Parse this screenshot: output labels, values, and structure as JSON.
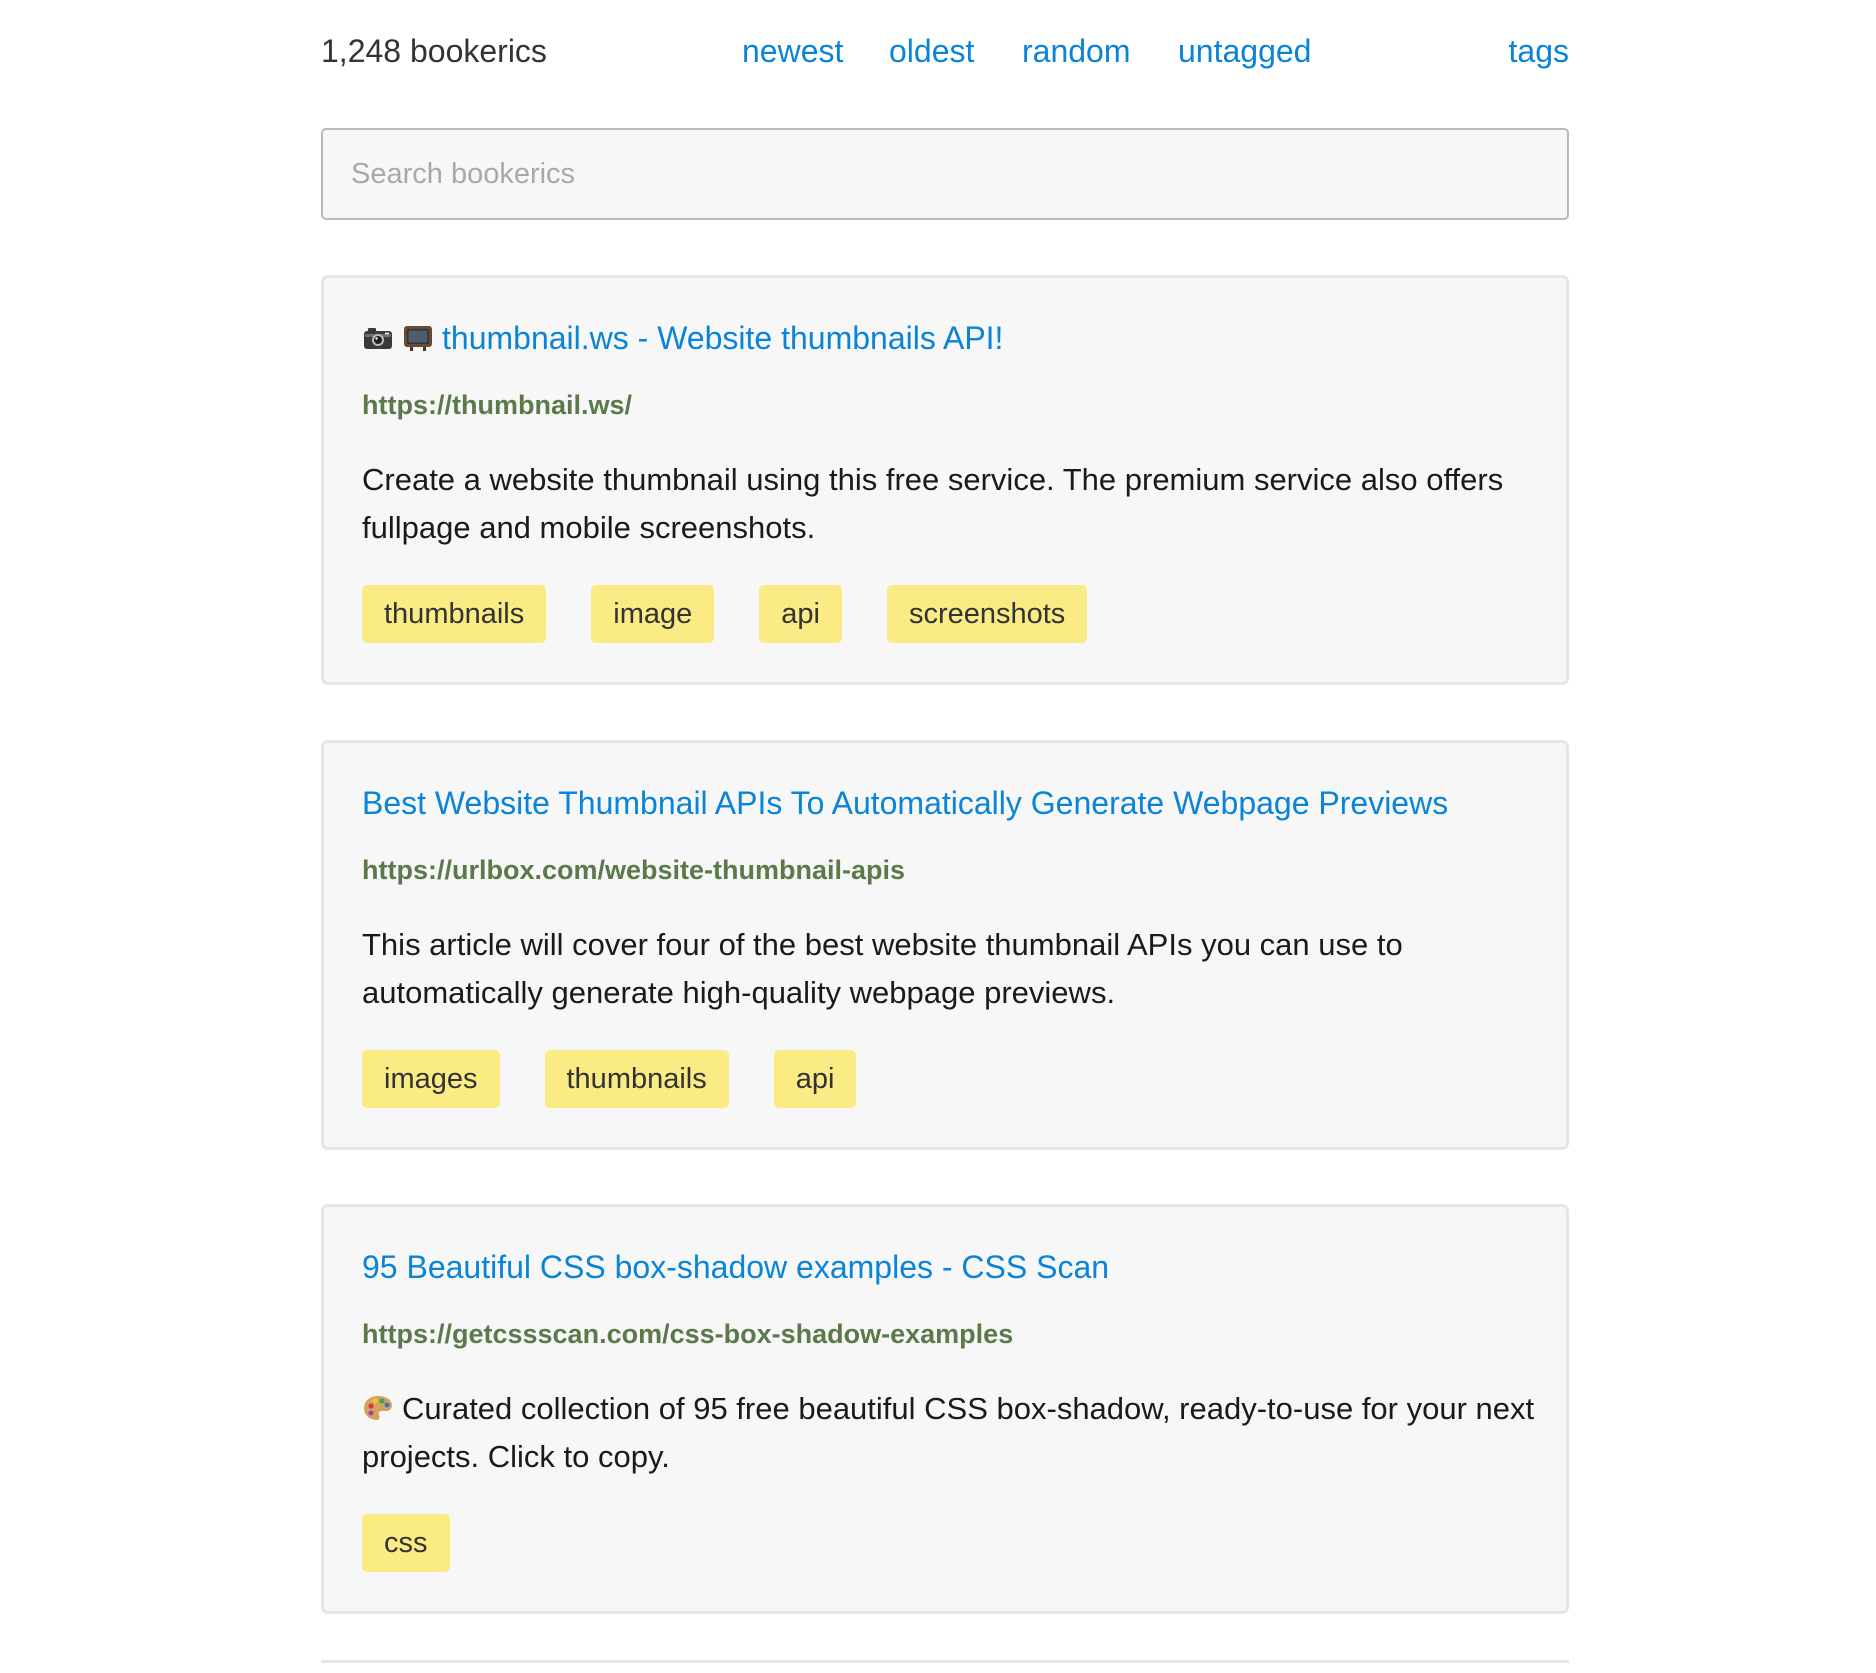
{
  "header": {
    "count_label": "1,248 bookerics",
    "nav": [
      "newest",
      "oldest",
      "random",
      "untagged"
    ],
    "tags_link": "tags"
  },
  "search": {
    "placeholder": "Search bookerics",
    "value": ""
  },
  "bookmarks": [
    {
      "icons": [
        "camera-icon",
        "tv-icon"
      ],
      "title": "thumbnail.ws - Website thumbnails API!",
      "url": "https://thumbnail.ws/",
      "description": "Create a website thumbnail using this free service. The premium service also offers fullpage and mobile screenshots.",
      "tags": [
        "thumbnails",
        "image",
        "api",
        "screenshots"
      ]
    },
    {
      "icons": [],
      "title": "Best Website Thumbnail APIs To Automatically Generate Webpage Previews",
      "url": "https://urlbox.com/website-thumbnail-apis",
      "description": "This article will cover four of the best website thumbnail APIs you can use to automatically generate high-quality webpage previews.",
      "tags": [
        "images",
        "thumbnails",
        "api"
      ]
    },
    {
      "icons": [],
      "title": "95 Beautiful CSS box-shadow examples - CSS Scan",
      "url": "https://getcssscan.com/css-box-shadow-examples",
      "description_icon": "palette-icon",
      "description": "Curated collection of 95 free beautiful CSS box-shadow, ready-to-use for your next projects. Click to copy.",
      "tags": [
        "css"
      ]
    }
  ],
  "colors": {
    "link": "#0a84d6",
    "url": "#5a7a4a",
    "tag_bg": "#fbeb84",
    "card_bg": "#f7f7f7",
    "card_border": "#e6e6e6"
  }
}
